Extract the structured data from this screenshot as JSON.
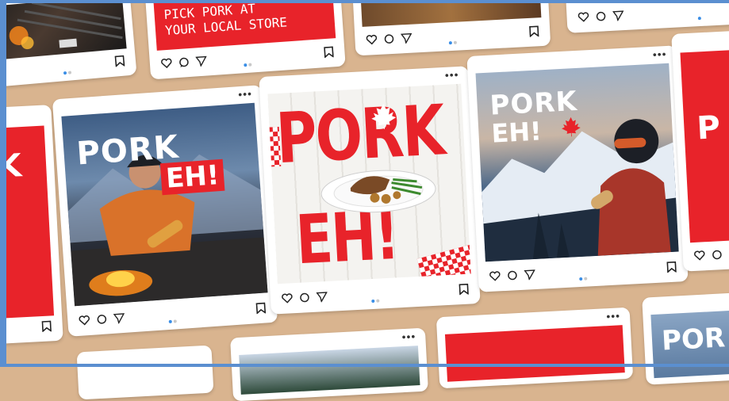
{
  "posts": {
    "retail": {
      "line1": "PICK PORK AT",
      "line2": "YOUR LOCAL STORE"
    },
    "hiker": {
      "headline1": "PORK",
      "headline2": "EH!"
    },
    "plate": {
      "headline1": "PORK",
      "headline2": "EH!"
    },
    "skier": {
      "headline1": "PORK",
      "headline2": "EH!"
    },
    "partial_right": {
      "headline1": "P"
    },
    "partial_bottom_right": {
      "headline1": "POR"
    },
    "partial_left": {
      "headline1": "K"
    }
  },
  "icons": [
    "heart-icon",
    "comment-icon",
    "send-icon",
    "bookmark-icon",
    "more-icon"
  ],
  "colors": {
    "brand_red": "#e8232a",
    "background": "#d9b48f",
    "accent_blue": "#3a8ee6"
  }
}
